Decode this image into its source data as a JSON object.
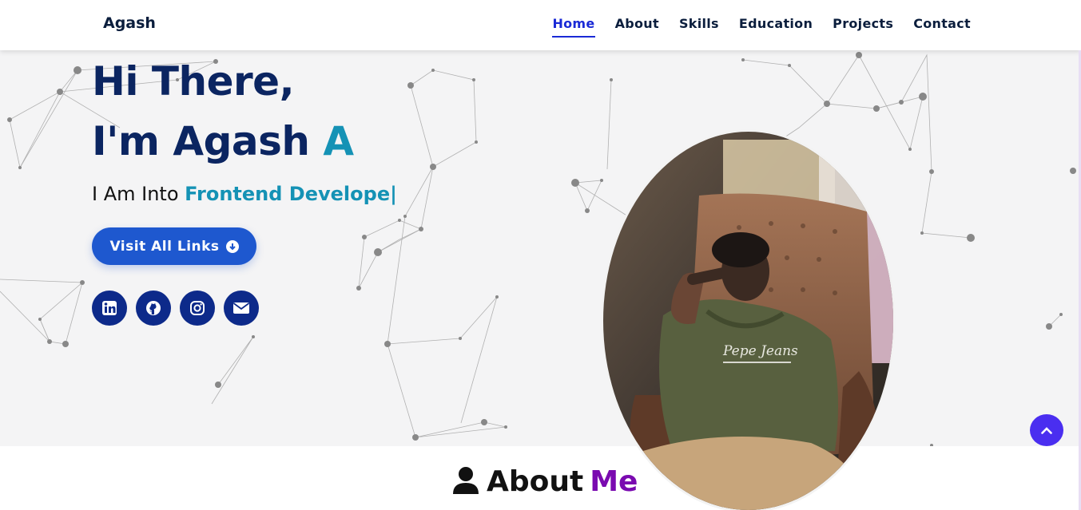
{
  "header": {
    "brand": "Agash",
    "nav": [
      {
        "label": "Home",
        "active": true
      },
      {
        "label": "About",
        "active": false
      },
      {
        "label": "Skills",
        "active": false
      },
      {
        "label": "Education",
        "active": false
      },
      {
        "label": "Projects",
        "active": false
      },
      {
        "label": "Contact",
        "active": false
      }
    ]
  },
  "hero": {
    "line1": "Hi There,",
    "line2_prefix": "I'm Agash ",
    "line2_accent": "A",
    "typing_prefix": "I Am Into ",
    "typing_role": "Frontend Develope|",
    "cta_label": "Visit All Links",
    "socials": [
      "linkedin-icon",
      "github-icon",
      "instagram-icon",
      "envelope-icon"
    ]
  },
  "about": {
    "word1": "About",
    "word2": "Me"
  },
  "colors": {
    "navy": "#0b2561",
    "accent": "#1592b5",
    "button": "#1e58cf",
    "social": "#0d2a8a",
    "purple": "#7a0ab0",
    "scroll": "#4a2ef0"
  }
}
